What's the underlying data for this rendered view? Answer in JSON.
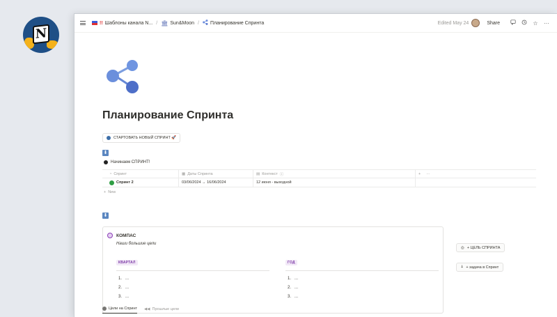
{
  "breadcrumbs": [
    {
      "prefix": "!!",
      "label": "Шаблоны канала N..."
    },
    {
      "label": "Sun&Moon"
    },
    {
      "label": "Планирование Спринта"
    }
  ],
  "topbar": {
    "edited": "Edited May 24",
    "share": "Share"
  },
  "page": {
    "title": "Планирование Спринта",
    "start_button": "СТАРТОВАТЬ НОВЫЙ СПРИНТ 🚀",
    "toggle_label": "Начинаем СПРИНТ!"
  },
  "table": {
    "headers": [
      "Спринт",
      "Даты Спринта",
      "Контекст"
    ],
    "header_extra": [
      "+",
      "···"
    ],
    "rows": [
      {
        "sprint": "Спринт 2",
        "dates": "03/06/2024 → 16/06/2024",
        "context": "12 июня - выходной"
      }
    ],
    "new_label": "New"
  },
  "kompas": {
    "title": "КОМПАС",
    "subtitle": "Наши большие цели",
    "quarter_chip": "КВАРТАЛ",
    "year_chip": "ГОД",
    "quarter_items": [
      "1.",
      "2.",
      "3."
    ],
    "year_items": [
      "1.",
      "2.",
      "3."
    ],
    "placeholder": "..."
  },
  "side_buttons": {
    "sprint_goal": "+ ЦЕЛЬ СПРИНТА",
    "sprint_task": "+ задача в Спринт"
  },
  "tabs": [
    {
      "label": "Цели на Спринт"
    },
    {
      "label": "Прошлые цели"
    }
  ],
  "colors": {
    "accent_blue": "#5a86c0",
    "status_green": "#2f9e44",
    "compass_purple": "#8b3fb7"
  }
}
